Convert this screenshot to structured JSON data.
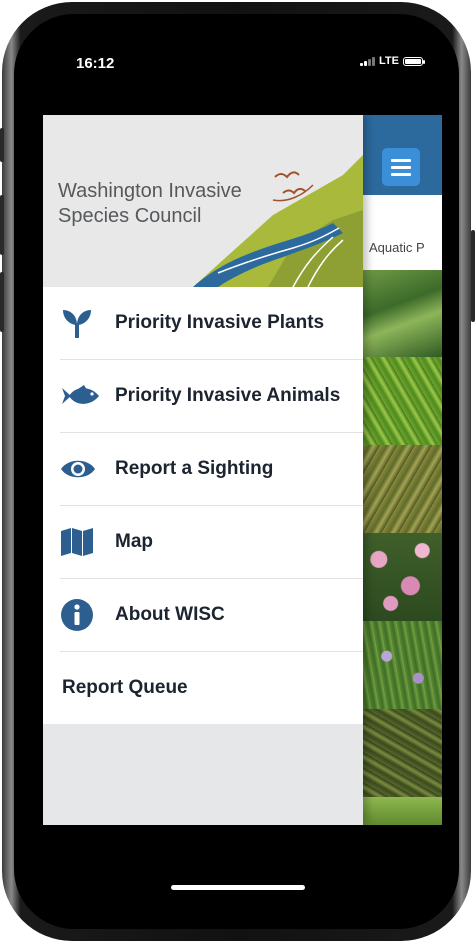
{
  "status_bar": {
    "time": "16:12",
    "network": "LTE"
  },
  "background_app": {
    "section_label": "Aquatic P"
  },
  "drawer": {
    "logo": {
      "line1": "Washington Invasive",
      "line2": "Species Council"
    },
    "menu": [
      {
        "label": "Priority Invasive Plants",
        "icon": "sprout-icon"
      },
      {
        "label": "Priority Invasive Animals",
        "icon": "fish-icon"
      },
      {
        "label": "Report a Sighting",
        "icon": "eye-icon"
      },
      {
        "label": "Map",
        "icon": "map-icon"
      },
      {
        "label": "About WISC",
        "icon": "info-icon"
      },
      {
        "label": "Report Queue",
        "icon": ""
      }
    ]
  },
  "colors": {
    "accent": "#2c6a9e",
    "icon": "#2c5f8f",
    "green": "#a9b93c"
  }
}
